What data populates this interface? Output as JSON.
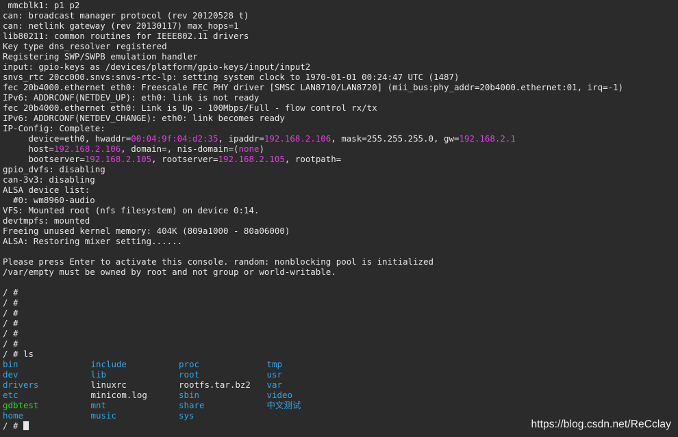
{
  "boot_log": [
    " mmcblk1: p1 p2",
    "can: broadcast manager protocol (rev 20120528 t)",
    "can: netlink gateway (rev 20130117) max_hops=1",
    "lib80211: common routines for IEEE802.11 drivers",
    "Key type dns_resolver registered",
    "Registering SWP/SWPB emulation handler",
    "input: gpio-keys as /devices/platform/gpio-keys/input/input2",
    "snvs_rtc 20cc000.snvs:snvs-rtc-lp: setting system clock to 1970-01-01 00:24:47 UTC (1487)",
    "fec 20b4000.ethernet eth0: Freescale FEC PHY driver [SMSC LAN8710/LAN8720] (mii_bus:phy_addr=20b4000.ethernet:01, irq=-1)",
    "IPv6: ADDRCONF(NETDEV_UP): eth0: link is not ready",
    "fec 20b4000.ethernet eth0: Link is Up - 100Mbps/Full - flow control rx/tx",
    "IPv6: ADDRCONF(NETDEV_CHANGE): eth0: link becomes ready",
    "IP-Config: Complete:"
  ],
  "ipconfig": {
    "device_prefix": "     device=eth0, hwaddr=",
    "hwaddr": "00:04:9f:04:d2:35",
    "ipaddr_label": ", ipaddr=",
    "ipaddr": "192.168.2.106",
    "mask_gw_label": ", mask=255.255.255.0, gw=",
    "gw": "192.168.2.1",
    "host_prefix": "     host=",
    "host": "192.168.2.106",
    "domain_label": ", domain=, nis-domain=(",
    "nis_domain": "none",
    "domain_close": ")",
    "bootserver_prefix": "     bootserver=",
    "bootserver": "192.168.2.105",
    "rootserver_label": ", rootserver=",
    "rootserver": "192.168.2.105",
    "rootpath_label": ", rootpath="
  },
  "boot_log_2": [
    "gpio_dvfs: disabling",
    "can-3v3: disabling",
    "ALSA device list:",
    "  #0: wm8960-audio",
    "VFS: Mounted root (nfs filesystem) on device 0:14.",
    "devtmpfs: mounted",
    "Freeing unused kernel memory: 404K (809a1000 - 80a06000)",
    "ALSA: Restoring mixer setting......",
    "",
    "Please press Enter to activate this console. random: nonblocking pool is initialized",
    "/var/empty must be owned by root and not group or world-writable.",
    ""
  ],
  "prompts": [
    "/ #",
    "/ #",
    "/ #",
    "/ #",
    "/ #",
    "/ #"
  ],
  "ls_command": "/ # ls",
  "ls_rows": [
    [
      {
        "name": "bin",
        "kind": "dir"
      },
      {
        "name": "include",
        "kind": "dir"
      },
      {
        "name": "proc",
        "kind": "dir"
      },
      {
        "name": "tmp",
        "kind": "dir"
      }
    ],
    [
      {
        "name": "dev",
        "kind": "dir"
      },
      {
        "name": "lib",
        "kind": "dir"
      },
      {
        "name": "root",
        "kind": "dir"
      },
      {
        "name": "usr",
        "kind": "dir"
      }
    ],
    [
      {
        "name": "drivers",
        "kind": "dir"
      },
      {
        "name": "linuxrc",
        "kind": "file"
      },
      {
        "name": "rootfs.tar.bz2",
        "kind": "file"
      },
      {
        "name": "var",
        "kind": "dir"
      }
    ],
    [
      {
        "name": "etc",
        "kind": "dir"
      },
      {
        "name": "minicom.log",
        "kind": "file"
      },
      {
        "name": "sbin",
        "kind": "dir"
      },
      {
        "name": "video",
        "kind": "dir"
      }
    ],
    [
      {
        "name": "gdbtest",
        "kind": "exe"
      },
      {
        "name": "mnt",
        "kind": "dir"
      },
      {
        "name": "share",
        "kind": "dir"
      },
      {
        "name": "中文测试",
        "kind": "dir"
      }
    ],
    [
      {
        "name": "home",
        "kind": "dir"
      },
      {
        "name": "music",
        "kind": "dir"
      },
      {
        "name": "sys",
        "kind": "dir"
      },
      {
        "name": "",
        "kind": "file"
      }
    ]
  ],
  "final_prompt": "/ # ",
  "watermark": "https://blog.csdn.net/ReCclay",
  "colors": {
    "background": "#2b2b2b",
    "foreground": "#e6e6e6",
    "ip_highlight": "#e040e0",
    "directory": "#2fa8e8",
    "executable": "#2fd02f"
  }
}
